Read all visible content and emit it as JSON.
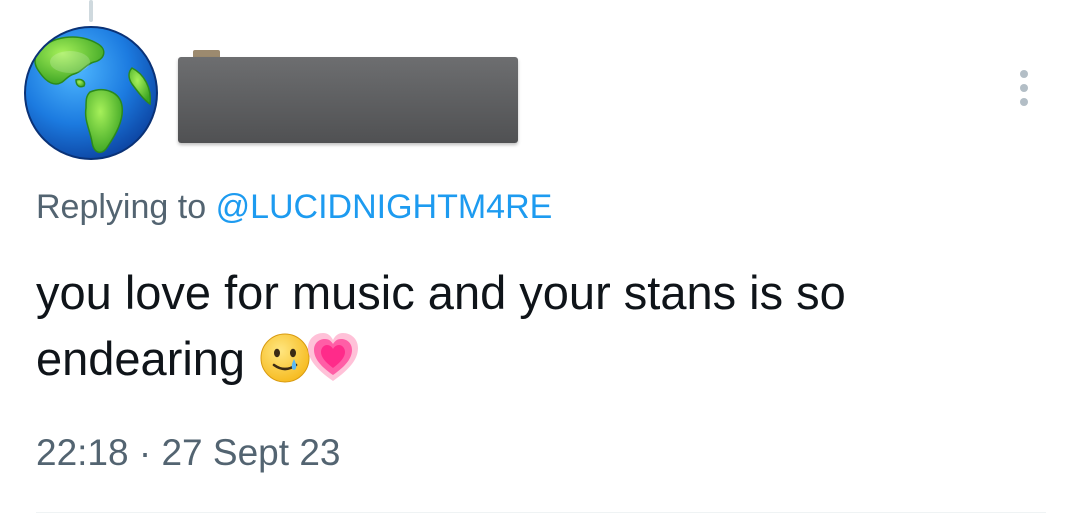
{
  "tweet": {
    "reply_prefix": "Replying to",
    "reply_handle": "@LUCIDNIGHTM4RE",
    "text": "you love for music and your stans is so endearing",
    "emojis": [
      "smiling-face-with-tear-icon",
      "growing-heart-icon"
    ],
    "time": "22:18",
    "separator": "·",
    "date": "27 Sept 23"
  },
  "avatar": {
    "icon": "globe-icon"
  },
  "header": {
    "more_icon": "more-vertical-icon"
  },
  "colors": {
    "link": "#1d9bf0",
    "secondary_text": "#536471",
    "primary_text": "#0f1419",
    "redaction": "#5d5e60"
  }
}
